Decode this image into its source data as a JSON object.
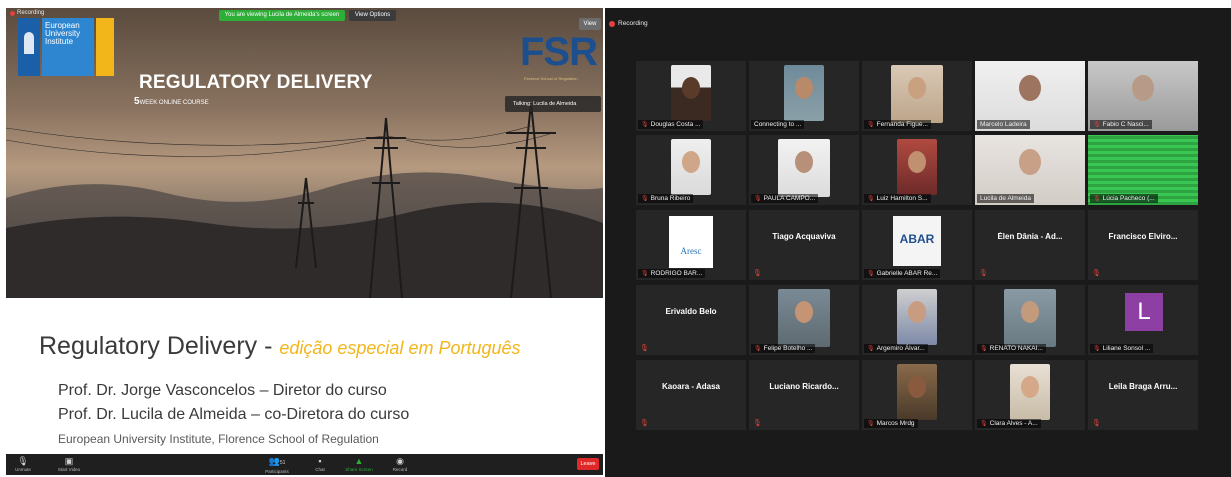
{
  "share": {
    "recording_label": "Recording",
    "viewing_banner": "You are viewing Lucila de Almeida's screen",
    "view_options": "View Options",
    "view_button": "View",
    "talking": "Talking: Lucila de Almeida",
    "logo_text": "European University Institute",
    "fsr_logo": "FSR",
    "fsr_sub": "Florence School of Regulation",
    "course_title": "REGULATORY DELIVERY",
    "course_number": "5",
    "course_sub": "WEEK ONLINE COURSE",
    "slide_heading": "Regulatory Delivery - ",
    "slide_heading_accent": "edição especial em Português",
    "line1": "Prof. Dr. Jorge Vasconcelos – Diretor do curso",
    "line2": "Prof. Dr. Lucila de Almeida – co-Diretora do curso",
    "line3": "European University Institute, Florence School of Regulation"
  },
  "toolbar": {
    "unmute": "Unmute",
    "start_video": "Start Video",
    "participants": "Participants",
    "participants_count": "51",
    "chat": "Chat",
    "share_screen": "Share Screen",
    "record": "Record",
    "leave": "Leave"
  },
  "gallery": {
    "recording_label": "Recording",
    "tiles": [
      {
        "label": "Douglas Costa ...",
        "kind": "photo"
      },
      {
        "label": "Connecting to ...",
        "kind": "photo"
      },
      {
        "label": "Fernanda Figue...",
        "kind": "photo"
      },
      {
        "label": "Marcelo Ladeira",
        "kind": "photo"
      },
      {
        "label": "Fabio C Nasci...",
        "kind": "photo"
      },
      {
        "label": "Bruna Ribeiro",
        "kind": "photo"
      },
      {
        "label": "PAULA CAMPO...",
        "kind": "photo"
      },
      {
        "label": "Luiz Hamilton S...",
        "kind": "photo"
      },
      {
        "label": "Lucila de Almeida",
        "kind": "photo",
        "active": true
      },
      {
        "label": "Lúcia Pacheco (...",
        "kind": "photo"
      },
      {
        "label": "RODRIGO BAR...",
        "kind": "logo",
        "logo": "Aresc"
      },
      {
        "name": "Tiago Acquaviva",
        "kind": "name"
      },
      {
        "label": "Gabrielle ABAR Re...",
        "kind": "logo",
        "logo": "ABAR"
      },
      {
        "name": "Élen Dânia - Ad...",
        "kind": "name"
      },
      {
        "name": "Francisco Elviro...",
        "kind": "name"
      },
      {
        "name": "Erivaldo Belo",
        "kind": "name"
      },
      {
        "label": "Felipe Botelho ...",
        "kind": "photo"
      },
      {
        "label": "Argemiro Álvar...",
        "kind": "photo"
      },
      {
        "label": "RENATO NAKAI...",
        "kind": "photo"
      },
      {
        "label": "Liliane Sonsol ...",
        "kind": "avatar",
        "initial": "L"
      },
      {
        "name": "Kaoara - Adasa",
        "kind": "name"
      },
      {
        "name": "Luciano Ricardo...",
        "kind": "name"
      },
      {
        "label": "Marcos Mrdg",
        "kind": "photo"
      },
      {
        "label": "Clara Alves - A...",
        "kind": "photo"
      },
      {
        "name": "Leila Braga Arru...",
        "kind": "name"
      }
    ]
  },
  "colors": {
    "recording_dot": "#e0433b",
    "active_speaker": "#c7d95a",
    "banner_green": "#2dae36",
    "leave_red": "#e02828",
    "accent_yellow": "#f2b61b",
    "avatar_purple": "#8e3fa3"
  }
}
